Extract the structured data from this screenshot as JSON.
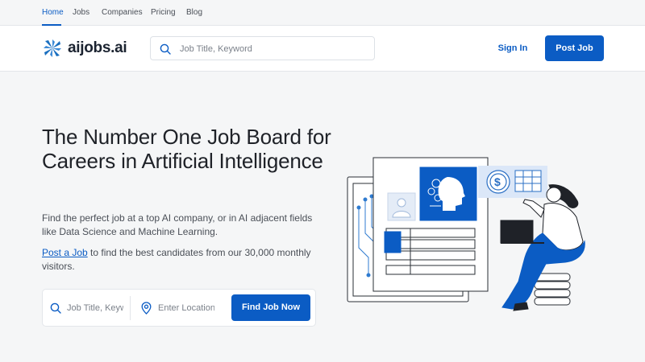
{
  "topnav": {
    "items": [
      {
        "label": "Home",
        "active": true
      },
      {
        "label": "Jobs",
        "active": false
      },
      {
        "label": "Companies",
        "active": false
      },
      {
        "label": "Pricing",
        "active": false
      },
      {
        "label": "Blog",
        "active": false
      }
    ]
  },
  "header": {
    "logo_text": "aijobs.ai",
    "search_placeholder": "Job Title, Keyword",
    "signin_label": "Sign In",
    "postjob_label": "Post Job"
  },
  "hero": {
    "title": "The Number One Job Board for Careers in Artificial Intelligence",
    "description": "Find the perfect job at a top AI company, or in AI adjacent fields like Data Science and Machine Learning.",
    "cta_link": "Post a Job",
    "cta_rest": " to find the best candidates from our 30,000 monthly visitors."
  },
  "find": {
    "keyword_placeholder": "Job Title, Keyword",
    "location_placeholder": "Enter Location",
    "button_label": "Find Job Now"
  },
  "colors": {
    "brand": "#0b5cc4",
    "text": "#1f2228",
    "background": "#f5f6f7"
  }
}
